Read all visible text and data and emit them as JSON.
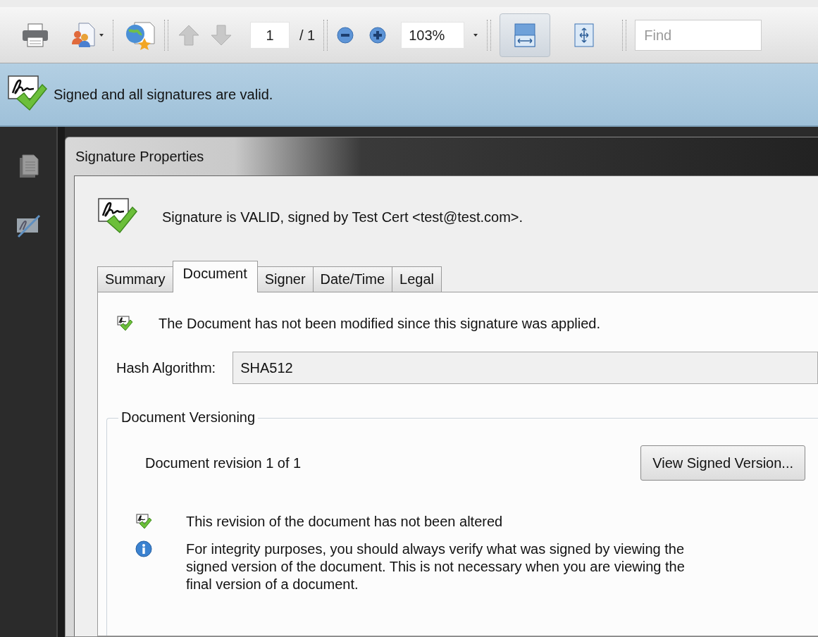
{
  "toolbar": {
    "page_number": "1",
    "page_count": "/ 1",
    "zoom": "103%",
    "view_modes": [
      {
        "kind": "fit-width",
        "selected": true
      },
      {
        "kind": "fit-page",
        "selected": false
      }
    ],
    "find": {
      "placeholder": "Find"
    }
  },
  "signature_bar": {
    "message": "Signed and all signatures are valid."
  },
  "dialog": {
    "title": "Signature Properties",
    "status_message": "Signature is VALID, signed by Test Cert <test@test.com>.",
    "tabs": [
      {
        "label": "Summary",
        "selected": false
      },
      {
        "label": "Document",
        "selected": true
      },
      {
        "label": "Signer",
        "selected": false
      },
      {
        "label": "Date/Time",
        "selected": false
      },
      {
        "label": "Legal",
        "selected": false
      }
    ],
    "document_tab": {
      "status_message": "The Document has not been modified since this signature was applied.",
      "hash_algorithm": {
        "label": "Hash Algorithm:",
        "value": "SHA512"
      },
      "versioning": {
        "legend": "Document Versioning",
        "revision": "Document revision 1 of 1",
        "button": "View Signed Version...",
        "notes": [
          {
            "kind": "check",
            "text": "This revision of the document has not been altered"
          },
          {
            "kind": "info",
            "text": "For integrity purposes, you should always verify what was signed by viewing the signed version of the document. This is not necessary when you are viewing the final version of a document."
          }
        ]
      }
    }
  }
}
